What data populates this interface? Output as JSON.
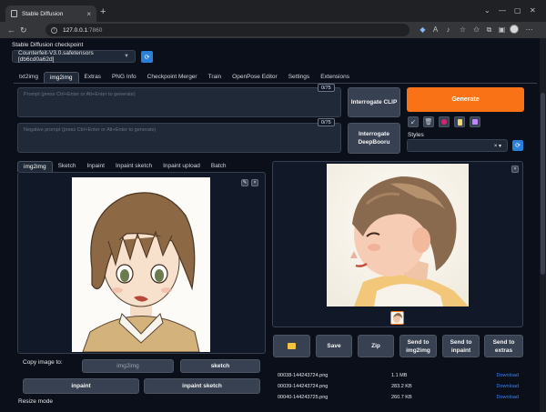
{
  "browser": {
    "tab_title": "Stable Diffusion",
    "url_host": "127.0.0.1",
    "url_port": ":7860"
  },
  "checkpoint": {
    "label": "Stable Diffusion checkpoint",
    "value": "Counterfeit-V3.0.safetensors [db6cd0a62d]"
  },
  "main_tabs": [
    "txt2img",
    "img2img",
    "Extras",
    "PNG Info",
    "Checkpoint Merger",
    "Train",
    "OpenPose Editor",
    "Settings",
    "Extensions"
  ],
  "prompt": {
    "placeholder": "Prompt (press Ctrl+Enter or Alt+Enter to generate)",
    "counter": "0/75"
  },
  "negative_prompt": {
    "placeholder": "Negative prompt (press Ctrl+Enter or Alt+Enter to generate)",
    "counter": "0/75"
  },
  "buttons": {
    "interrogate_clip": "Interrogate CLIP",
    "interrogate_deepbooru": "Interrogate DeepBooru",
    "generate": "Generate"
  },
  "styles": {
    "label": "Styles"
  },
  "sub_tabs": [
    "img2img",
    "Sketch",
    "Inpaint",
    "Inpaint sketch",
    "Inpaint upload",
    "Batch"
  ],
  "copy_image": {
    "label": "Copy image to:",
    "img2img": "img2img",
    "sketch": "sketch",
    "inpaint": "inpaint",
    "inpaint_sketch": "inpaint sketch"
  },
  "resize_mode_label": "Resize mode",
  "output_buttons": {
    "save": "Save",
    "zip": "Zip",
    "send_img2img": "Send to img2img",
    "send_inpaint": "Send to inpaint",
    "send_extras": "Send to extras"
  },
  "files": [
    {
      "name": "00038-144243724.png",
      "size": "1.1 MB",
      "action": "Download"
    },
    {
      "name": "00039-144243724.png",
      "size": "283.2 KB",
      "action": "Download"
    },
    {
      "name": "00040-144243725.png",
      "size": "260.7 KB",
      "action": "Download"
    }
  ],
  "colors": {
    "accent": "#f97316",
    "link": "#3b82f6",
    "background": "#0b0f19"
  }
}
